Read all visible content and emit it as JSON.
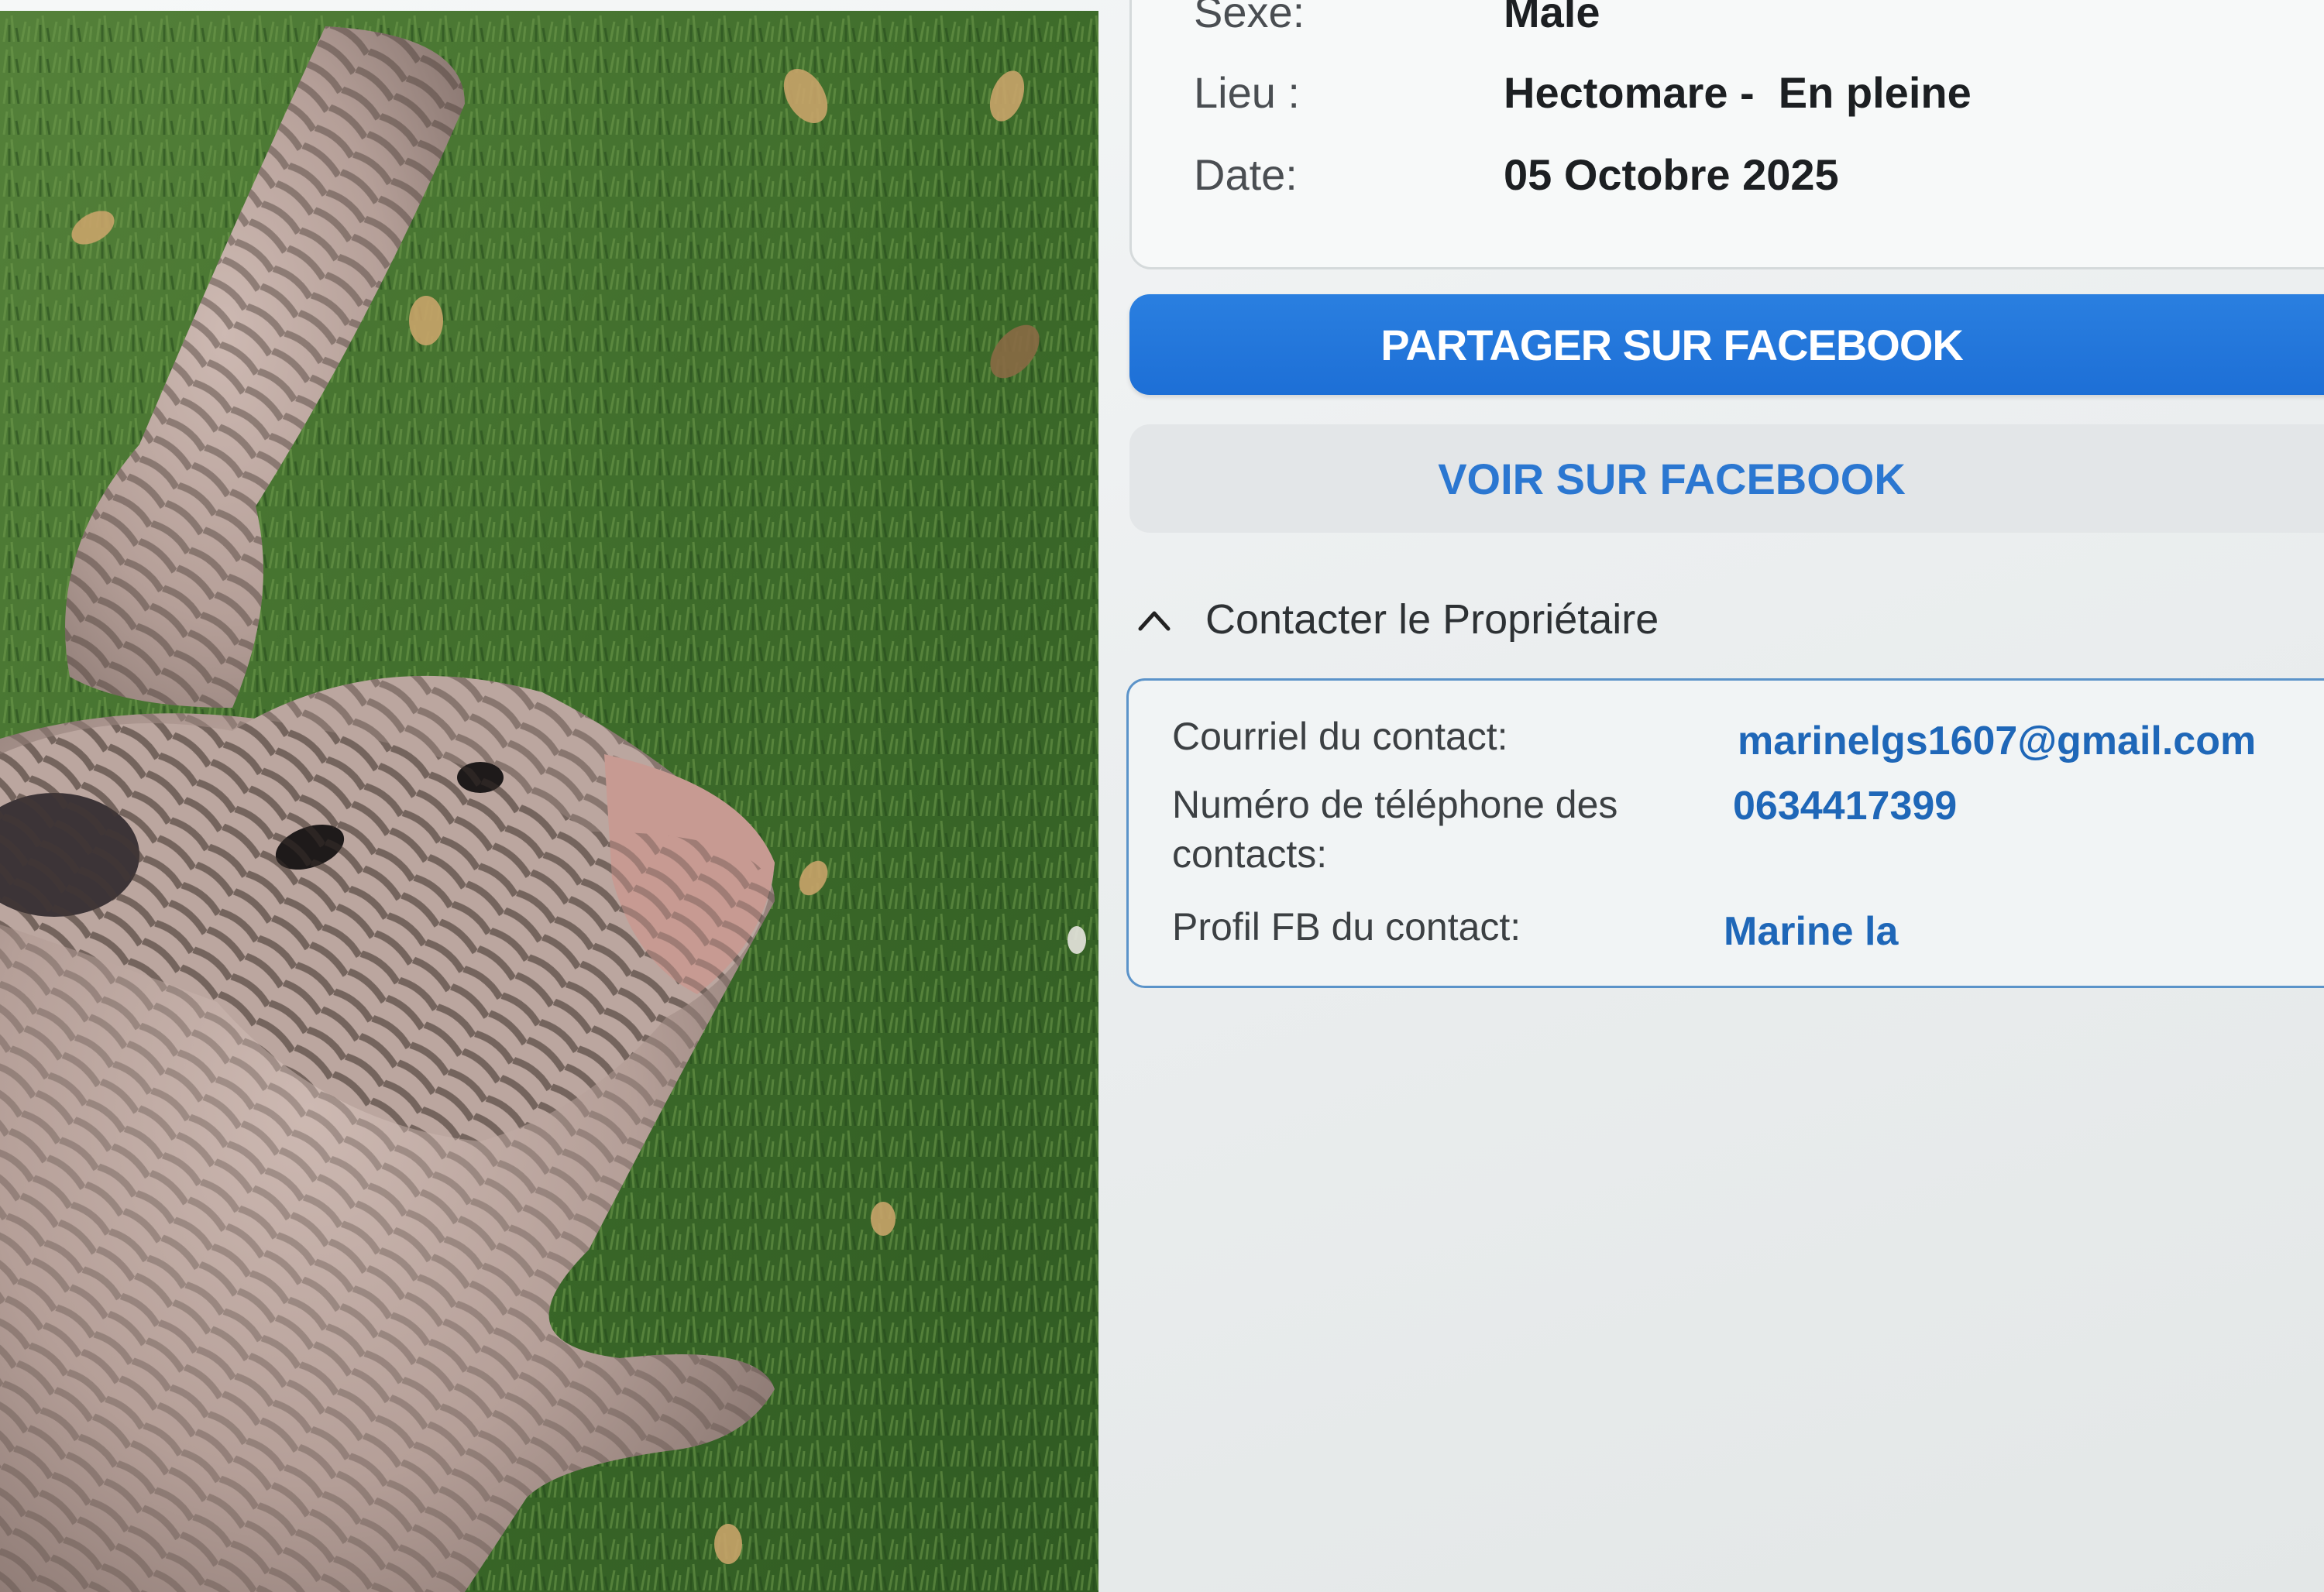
{
  "details": {
    "sexe": {
      "label": "Sexe:",
      "value": "Male"
    },
    "lieu": {
      "label": "Lieu :",
      "value": "Hectomare -  En pleine"
    },
    "date": {
      "label": "Date:",
      "value": "05 Octobre 2025"
    }
  },
  "buttons": {
    "share_facebook": "PARTAGER SUR FACEBOOK",
    "view_facebook": "VOIR SUR FACEBOOK"
  },
  "contact_section": {
    "title": "Contacter le Propriétaire",
    "expanded": true,
    "email": {
      "label": "Courriel du contact:",
      "value": "marinelgs1607@gmail.com"
    },
    "phone": {
      "label": "Numéro de téléphone des contacts:",
      "value": "0634417399"
    },
    "facebook": {
      "label": "Profil FB du contact:",
      "value": "Marine la"
    }
  },
  "colors": {
    "share_button": "#1d6fd6",
    "view_button_text": "#2b77d1",
    "link_value": "#1f67b8",
    "contact_card_border": "#5b93c9"
  },
  "icons": {
    "accordion": "chevron-up-icon"
  }
}
